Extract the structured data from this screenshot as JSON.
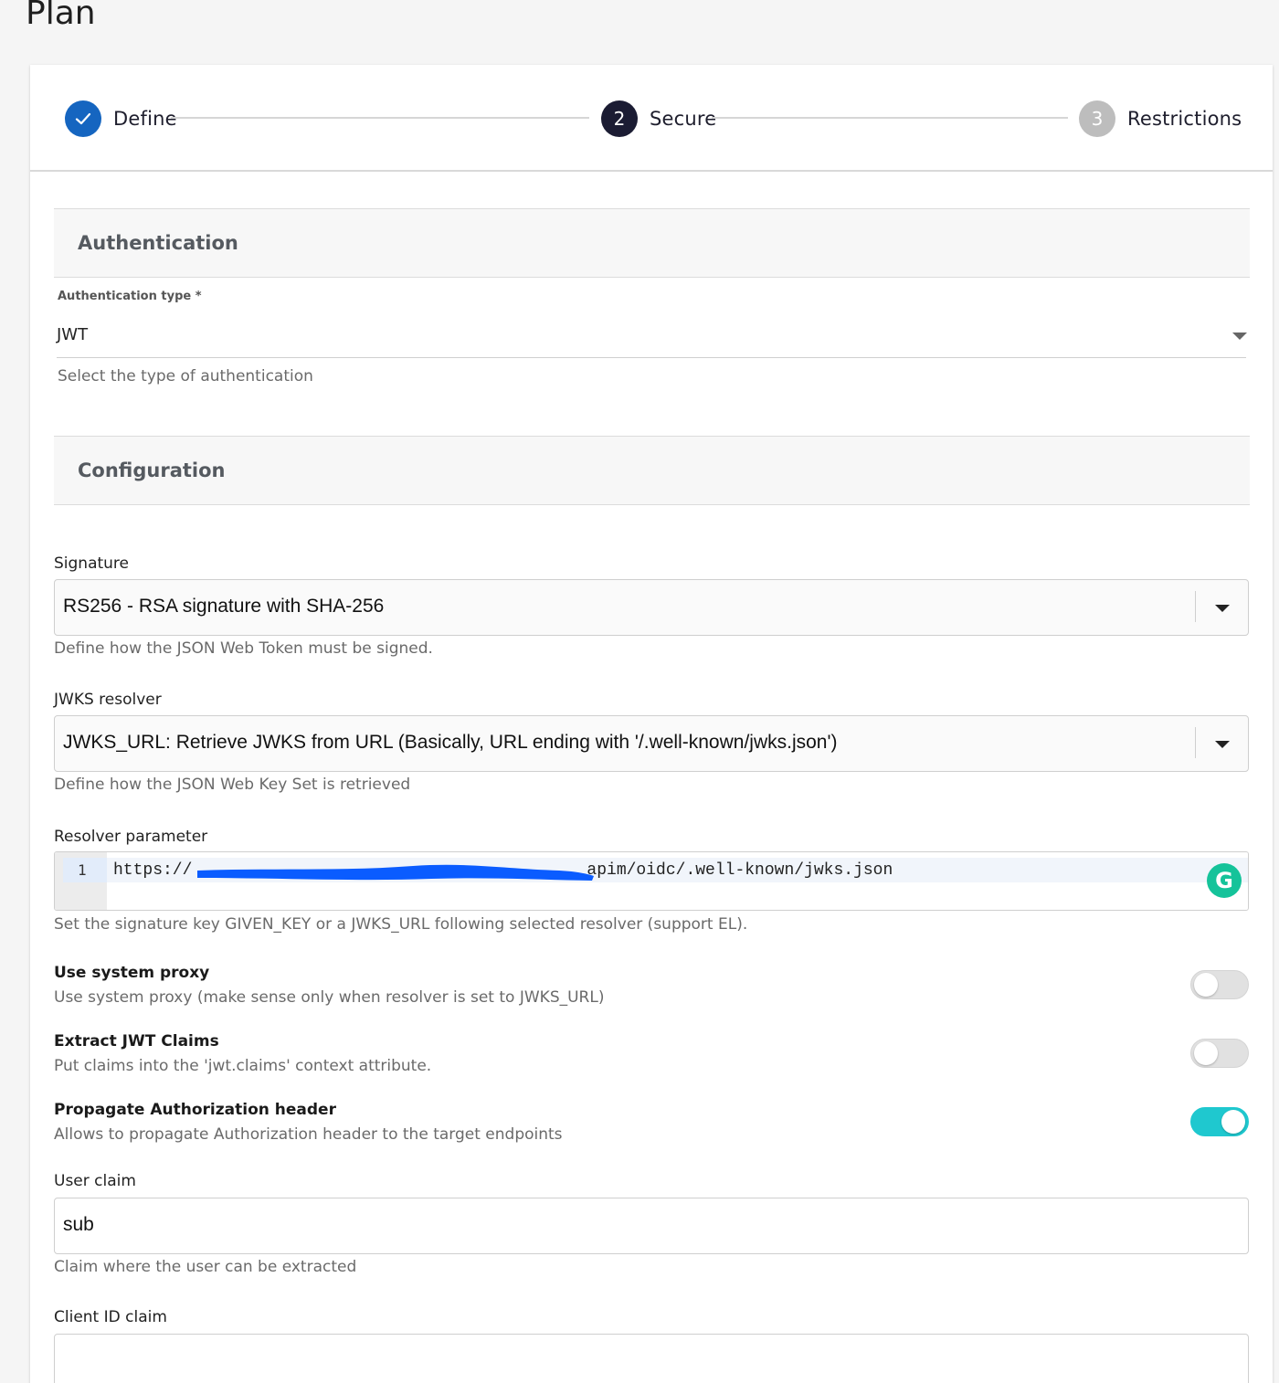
{
  "page": {
    "title": "Plan"
  },
  "stepper": {
    "steps": [
      {
        "number": "",
        "label": "Define",
        "state": "completed",
        "icon": "check-icon",
        "color": "#1565c0"
      },
      {
        "number": "2",
        "label": "Secure",
        "state": "active",
        "color": "#1b1c33"
      },
      {
        "number": "3",
        "label": "Restrictions",
        "state": "pending",
        "color": "#bdbdbd"
      }
    ]
  },
  "authentication": {
    "heading": "Authentication",
    "type_label": "Authentication type *",
    "type_value": "JWT",
    "type_hint": "Select the type of authentication"
  },
  "configuration": {
    "heading": "Configuration",
    "signature": {
      "label": "Signature",
      "value": "RS256 - RSA signature with SHA-256",
      "hint": "Define how the JSON Web Token must be signed."
    },
    "jwks_resolver": {
      "label": "JWKS resolver",
      "value": "JWKS_URL: Retrieve JWKS from URL (Basically, URL ending with '/.well-known/jwks.json')",
      "hint": "Define how the JSON Web Key Set is retrieved"
    },
    "resolver_parameter": {
      "label": "Resolver parameter",
      "line_number": "1",
      "code_prefix": "https://",
      "code_suffix": "apim/oidc/.well-known/jwks.json",
      "hint": "Set the signature key GIVEN_KEY or a JWKS_URL following selected resolver (support EL).",
      "grammarly_letter": "G"
    },
    "use_system_proxy": {
      "label": "Use system proxy",
      "hint": "Use system proxy (make sense only when resolver is set to JWKS_URL)",
      "enabled": false
    },
    "extract_jwt_claims": {
      "label": "Extract JWT Claims",
      "hint": "Put claims into the 'jwt.claims' context attribute.",
      "enabled": false
    },
    "propagate_auth_header": {
      "label": "Propagate Authorization header",
      "hint": "Allows to propagate Authorization header to the target endpoints",
      "enabled": true
    },
    "user_claim": {
      "label": "User claim",
      "value": "sub",
      "hint": "Claim where the user can be extracted"
    },
    "client_id_claim": {
      "label": "Client ID claim",
      "value": ""
    }
  },
  "colors": {
    "toggle_on": "#1fc8cf",
    "redaction": "#0a5cff",
    "grammarly": "#15c39a"
  }
}
